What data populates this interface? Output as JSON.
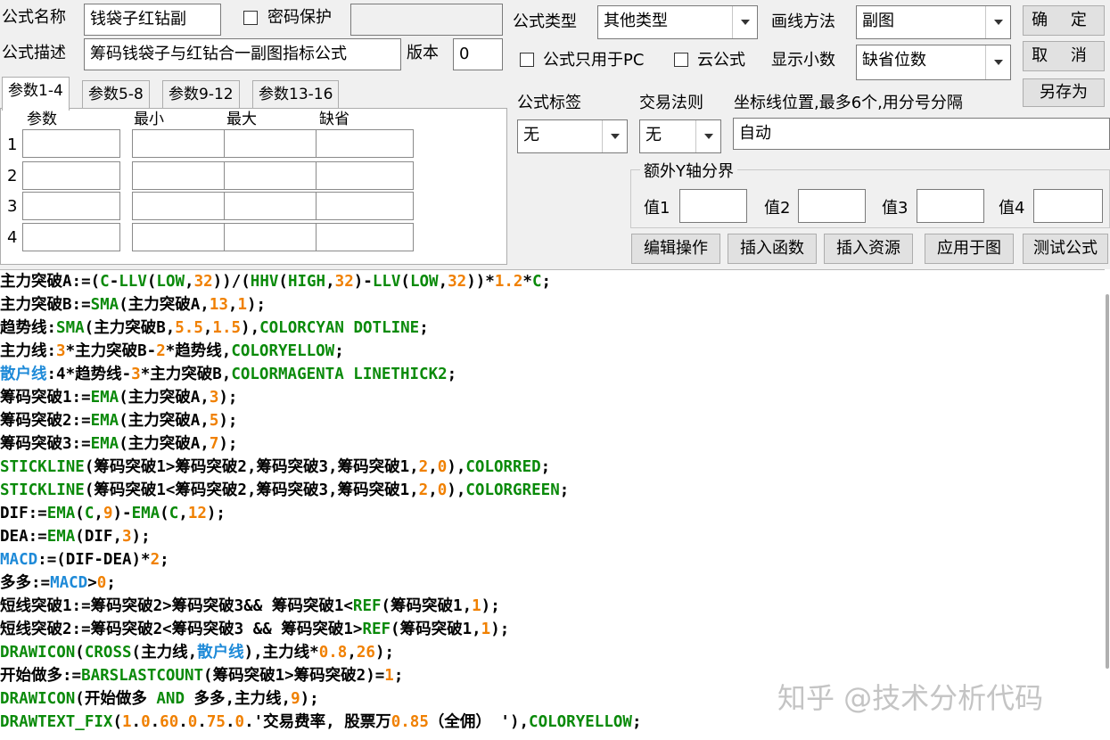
{
  "formula": {
    "name_label": "公式名称",
    "name_value": "钱袋子红钻副",
    "password_label": "密码保护",
    "password_value": "",
    "desc_label": "公式描述",
    "desc_value": "筹码钱袋子与红钻合一副图指标公式",
    "version_label": "版本",
    "version_value": "0",
    "type_label": "公式类型",
    "type_value": "其他类型",
    "draw_label": "画线方法",
    "draw_value": "副图",
    "pc_only_label": "公式只用于PC",
    "cloud_label": "云公式",
    "decimals_label": "显示小数",
    "decimals_value": "缺省位数",
    "tag_label": "公式标签",
    "tag_value": "无",
    "trade_label": "交易法则",
    "trade_value": "无",
    "axis_label": "坐标线位置,最多6个,用分号分隔",
    "axis_value": "自动",
    "extra_y_label": "额外Y轴分界",
    "val_labels": [
      "值1",
      "值2",
      "值3",
      "值4"
    ]
  },
  "buttons": {
    "ok": "确 定",
    "cancel": "取 消",
    "save_as": "另存为",
    "edit": "编辑操作",
    "insert_func": "插入函数",
    "insert_res": "插入资源",
    "apply": "应用于图",
    "test": "测试公式"
  },
  "tabs": [
    "参数1-4",
    "参数5-8",
    "参数9-12",
    "参数13-16"
  ],
  "param_headers": [
    "参数",
    "最小",
    "最大",
    "缺省"
  ],
  "param_rows": [
    "1",
    "2",
    "3",
    "4"
  ],
  "code_lines": [
    [
      [
        "p",
        "主力突破"
      ],
      [
        "p",
        "A:=("
      ],
      [
        "k",
        "C"
      ],
      [
        "p",
        "-"
      ],
      [
        "k",
        "LLV"
      ],
      [
        "p",
        "("
      ],
      [
        "k",
        "LOW"
      ],
      [
        "p",
        ","
      ],
      [
        "n",
        "32"
      ],
      [
        "p",
        "))/("
      ],
      [
        "k",
        "HHV"
      ],
      [
        "p",
        "("
      ],
      [
        "k",
        "HIGH"
      ],
      [
        "p",
        ","
      ],
      [
        "n",
        "32"
      ],
      [
        "p",
        ")-"
      ],
      [
        "k",
        "LLV"
      ],
      [
        "p",
        "("
      ],
      [
        "k",
        "LOW"
      ],
      [
        "p",
        ","
      ],
      [
        "n",
        "32"
      ],
      [
        "p",
        "))*"
      ],
      [
        "n",
        "1.2"
      ],
      [
        "p",
        "*"
      ],
      [
        "k",
        "C"
      ],
      [
        "p",
        ";"
      ]
    ],
    [
      [
        "p",
        "主力突破"
      ],
      [
        "p",
        "B:="
      ],
      [
        "k",
        "SMA"
      ],
      [
        "p",
        "(主力突破A,"
      ],
      [
        "n",
        "13"
      ],
      [
        "p",
        ","
      ],
      [
        "n",
        "1"
      ],
      [
        "p",
        ");"
      ]
    ],
    [
      [
        "p",
        "趋势线:"
      ],
      [
        "k",
        "SMA"
      ],
      [
        "p",
        "(主力突破B,"
      ],
      [
        "n",
        "5.5"
      ],
      [
        "p",
        ","
      ],
      [
        "n",
        "1.5"
      ],
      [
        "p",
        "),"
      ],
      [
        "k",
        "COLORCYAN DOTLINE"
      ],
      [
        "p",
        ";"
      ]
    ],
    [
      [
        "p",
        "主力线:"
      ],
      [
        "n",
        "3"
      ],
      [
        "p",
        "*主力突破B-"
      ],
      [
        "n",
        "2"
      ],
      [
        "p",
        "*趋势线,"
      ],
      [
        "k",
        "COLORYELLOW"
      ],
      [
        "p",
        ";"
      ]
    ],
    [
      [
        "b",
        "散户线"
      ],
      [
        "p",
        ":4*趋势线-"
      ],
      [
        "n",
        "3"
      ],
      [
        "p",
        "*主力突破B,"
      ],
      [
        "k",
        "COLORMAGENTA LINETHICK2"
      ],
      [
        "p",
        ";"
      ]
    ],
    [
      [
        "p",
        "筹码突破1:="
      ],
      [
        "k",
        "EMA"
      ],
      [
        "p",
        "(主力突破A,"
      ],
      [
        "n",
        "3"
      ],
      [
        "p",
        ");"
      ]
    ],
    [
      [
        "p",
        "筹码突破2:="
      ],
      [
        "k",
        "EMA"
      ],
      [
        "p",
        "(主力突破A,"
      ],
      [
        "n",
        "5"
      ],
      [
        "p",
        ");"
      ]
    ],
    [
      [
        "p",
        "筹码突破3:="
      ],
      [
        "k",
        "EMA"
      ],
      [
        "p",
        "(主力突破A,"
      ],
      [
        "n",
        "7"
      ],
      [
        "p",
        ");"
      ]
    ],
    [
      [
        "k",
        "STICKLINE"
      ],
      [
        "p",
        "(筹码突破1>筹码突破2,筹码突破3,筹码突破1,"
      ],
      [
        "n",
        "2"
      ],
      [
        "p",
        ","
      ],
      [
        "n",
        "0"
      ],
      [
        "p",
        "),"
      ],
      [
        "k",
        "COLORRED"
      ],
      [
        "p",
        ";"
      ]
    ],
    [
      [
        "k",
        "STICKLINE"
      ],
      [
        "p",
        "(筹码突破1<筹码突破2,筹码突破3,筹码突破1,"
      ],
      [
        "n",
        "2"
      ],
      [
        "p",
        ","
      ],
      [
        "n",
        "0"
      ],
      [
        "p",
        "),"
      ],
      [
        "k",
        "COLORGREEN"
      ],
      [
        "p",
        ";"
      ]
    ],
    [
      [
        "p",
        "DIF:="
      ],
      [
        "k",
        "EMA"
      ],
      [
        "p",
        "("
      ],
      [
        "k",
        "C"
      ],
      [
        "p",
        ","
      ],
      [
        "n",
        "9"
      ],
      [
        "p",
        ")-"
      ],
      [
        "k",
        "EMA"
      ],
      [
        "p",
        "("
      ],
      [
        "k",
        "C"
      ],
      [
        "p",
        ","
      ],
      [
        "n",
        "12"
      ],
      [
        "p",
        ");"
      ]
    ],
    [
      [
        "p",
        "DEA:="
      ],
      [
        "k",
        "EMA"
      ],
      [
        "p",
        "(DIF,"
      ],
      [
        "n",
        "3"
      ],
      [
        "p",
        ");"
      ]
    ],
    [
      [
        "b",
        "MACD"
      ],
      [
        "p",
        ":=(DIF-DEA)*"
      ],
      [
        "n",
        "2"
      ],
      [
        "p",
        ";"
      ]
    ],
    [
      [
        "p",
        "多多:="
      ],
      [
        "b",
        "MACD"
      ],
      [
        "p",
        ">"
      ],
      [
        "n",
        "0"
      ],
      [
        "p",
        ";"
      ]
    ],
    [
      [
        "p",
        "短线突破1:=筹码突破2>筹码突破3&& 筹码突破1<"
      ],
      [
        "k",
        "REF"
      ],
      [
        "p",
        "(筹码突破1,"
      ],
      [
        "n",
        "1"
      ],
      [
        "p",
        ");"
      ]
    ],
    [
      [
        "p",
        "短线突破2:=筹码突破2<筹码突破3 && 筹码突破1>"
      ],
      [
        "k",
        "REF"
      ],
      [
        "p",
        "(筹码突破1,"
      ],
      [
        "n",
        "1"
      ],
      [
        "p",
        ");"
      ]
    ],
    [
      [
        "k",
        "DRAWICON"
      ],
      [
        "p",
        "("
      ],
      [
        "k",
        "CROSS"
      ],
      [
        "p",
        "(主力线,"
      ],
      [
        "b",
        "散户线"
      ],
      [
        "p",
        "),主力线*"
      ],
      [
        "n",
        "0.8"
      ],
      [
        "p",
        ","
      ],
      [
        "n",
        "26"
      ],
      [
        "p",
        ");"
      ]
    ],
    [
      [
        "p",
        "开始做多:="
      ],
      [
        "k",
        "BARSLASTCOUNT"
      ],
      [
        "p",
        "(筹码突破1>筹码突破2)="
      ],
      [
        "n",
        "1"
      ],
      [
        "p",
        ";"
      ]
    ],
    [
      [
        "k",
        "DRAWICON"
      ],
      [
        "p",
        "(开始做多 "
      ],
      [
        "k",
        "AND"
      ],
      [
        "p",
        " 多多,主力线,"
      ],
      [
        "n",
        "9"
      ],
      [
        "p",
        ");"
      ]
    ],
    [
      [
        "k",
        "DRAWTEXT_FIX"
      ],
      [
        "p",
        "("
      ],
      [
        "n",
        "1"
      ],
      [
        "p",
        "."
      ],
      [
        "n",
        "0"
      ],
      [
        "p",
        "."
      ],
      [
        "n",
        "60"
      ],
      [
        "p",
        "."
      ],
      [
        "n",
        "0"
      ],
      [
        "p",
        "."
      ],
      [
        "n",
        "75"
      ],
      [
        "p",
        "."
      ],
      [
        "n",
        "0"
      ],
      [
        "p",
        ".'交易费率, 股票万"
      ],
      [
        "n",
        "0.85"
      ],
      [
        "p",
        "（全佣） '),"
      ],
      [
        "k",
        "COLORYELLOW"
      ],
      [
        "p",
        ";"
      ]
    ]
  ],
  "watermark": "知乎 @技术分析代码",
  "colors": {
    "keyword": "#0a8a0a",
    "number": "#f08000",
    "var_blue": "#1e8ad8"
  }
}
